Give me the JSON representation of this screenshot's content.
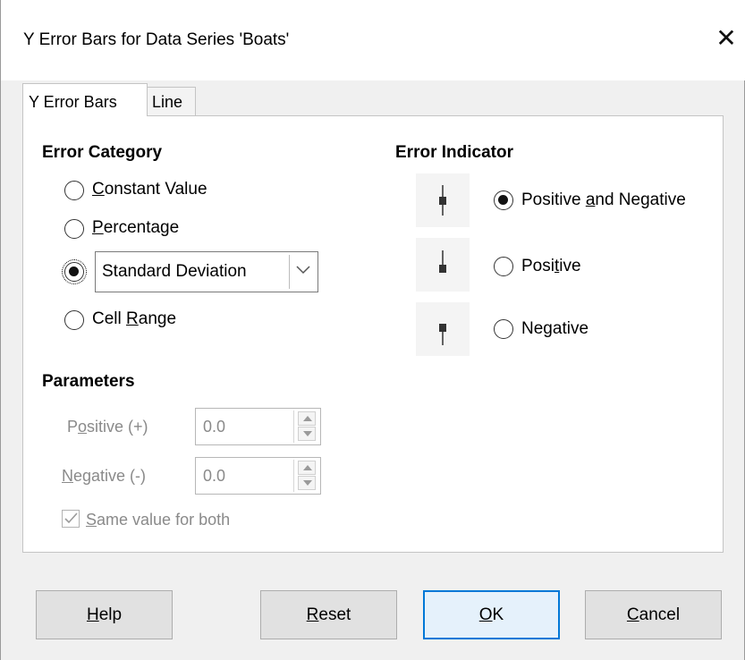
{
  "dialog": {
    "title": "Y Error Bars for Data Series 'Boats'",
    "close_glyph": "✕"
  },
  "tabs": [
    {
      "label": "Y Error Bars",
      "active": true
    },
    {
      "label": "Line",
      "active": false
    }
  ],
  "error_category": {
    "heading": "Error Category",
    "options": [
      {
        "label": "Constant Value",
        "mnemonic": "C",
        "rest": "onstant Value",
        "checked": false
      },
      {
        "label": "Percentage",
        "mnemonic": "P",
        "rest": "ercentage",
        "checked": false
      },
      {
        "label": "Standard Deviation",
        "checked": true
      },
      {
        "label": "Cell Range",
        "pre": "Cell ",
        "mnemonic": "R",
        "rest": "ange",
        "checked": false
      }
    ],
    "function_combo": {
      "value": "Standard Deviation"
    }
  },
  "parameters": {
    "heading": "Parameters",
    "positive": {
      "pre": "P",
      "mnemonic": "o",
      "rest": "sitive (+)",
      "label": "Positive (+)",
      "value": "0.0"
    },
    "negative": {
      "mnemonic": "N",
      "rest": "egative (-)",
      "label": "Negative (-)",
      "value": "0.0"
    },
    "same_value": {
      "mnemonic": "S",
      "rest": "ame value for both",
      "label": "Same value for both",
      "checked": true
    }
  },
  "error_indicator": {
    "heading": "Error Indicator",
    "options": [
      {
        "pre": "Positive ",
        "mnemonic": "a",
        "rest": "nd Negative",
        "label": "Positive and Negative",
        "checked": true,
        "icon": "error-bar-both-icon"
      },
      {
        "pre": "Posi",
        "mnemonic": "t",
        "rest": "ive",
        "label": "Positive",
        "checked": false,
        "icon": "error-bar-positive-icon"
      },
      {
        "pre": "Ne",
        "mnemonic": "g",
        "rest": "ative",
        "label": "Negative",
        "checked": false,
        "icon": "error-bar-negative-icon"
      }
    ]
  },
  "buttons": [
    {
      "mnemonic": "H",
      "rest": "elp",
      "label": "Help"
    },
    {
      "mnemonic": "R",
      "rest": "eset",
      "label": "Reset"
    },
    {
      "mnemonic": "O",
      "rest": "K",
      "label": "OK",
      "default": true
    },
    {
      "mnemonic": "C",
      "rest": "ancel",
      "label": "Cancel"
    }
  ],
  "colors": {
    "accent": "#0078d7",
    "disabled_text": "#8a8a8a",
    "dialog_bg": "#f0f0f0"
  }
}
